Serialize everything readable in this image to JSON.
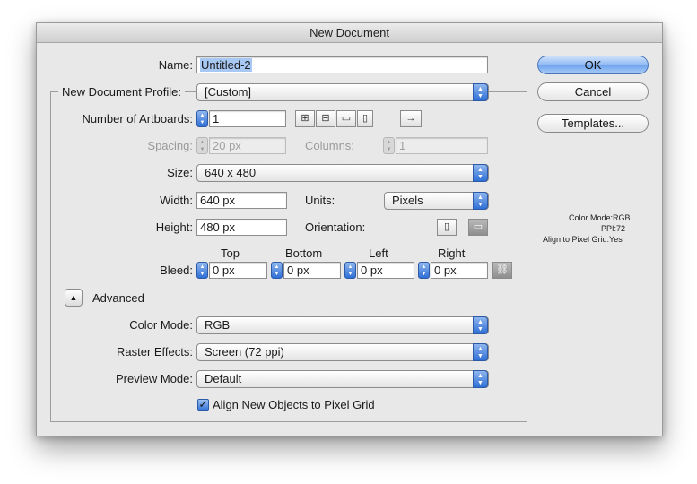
{
  "window": {
    "title": "New Document"
  },
  "name": {
    "label": "Name:",
    "value": "Untitled-2"
  },
  "profile": {
    "label": "New Document Profile:",
    "value": "[Custom]"
  },
  "artboards": {
    "label": "Number of Artboards:",
    "value": "1",
    "direction_arrow": "→"
  },
  "spacing": {
    "label": "Spacing:",
    "value": "20 px"
  },
  "columns": {
    "label": "Columns:",
    "value": "1"
  },
  "size": {
    "label": "Size:",
    "value": "640 x 480"
  },
  "width": {
    "label": "Width:",
    "value": "640 px"
  },
  "units": {
    "label": "Units:",
    "value": "Pixels"
  },
  "height": {
    "label": "Height:",
    "value": "480 px"
  },
  "orientation": {
    "label": "Orientation:"
  },
  "bleed": {
    "label": "Bleed:",
    "top": {
      "label": "Top",
      "value": "0 px"
    },
    "bottom": {
      "label": "Bottom",
      "value": "0 px"
    },
    "left": {
      "label": "Left",
      "value": "0 px"
    },
    "right": {
      "label": "Right",
      "value": "0 px"
    }
  },
  "advanced": {
    "label": "Advanced"
  },
  "color_mode": {
    "label": "Color Mode:",
    "value": "RGB"
  },
  "raster_effects": {
    "label": "Raster Effects:",
    "value": "Screen (72 ppi)"
  },
  "preview_mode": {
    "label": "Preview Mode:",
    "value": "Default"
  },
  "align_pixel_grid": {
    "label": "Align New Objects to Pixel Grid",
    "checked": true
  },
  "buttons": {
    "ok": "OK",
    "cancel": "Cancel",
    "templates": "Templates..."
  },
  "summary": {
    "color_mode_label": "Color Mode:",
    "color_mode_value": "RGB",
    "ppi_label": "PPI:",
    "ppi_value": "72",
    "align_label": "Align to Pixel Grid:",
    "align_value": "Yes"
  },
  "icons": {
    "stepper": "up-down-arrows-icon",
    "popup": "up-down-arrows-icon",
    "grid_by_row": "grid-by-row-icon",
    "grid_by_column": "grid-by-column-icon",
    "arrange_by_row": "arrange-by-row-icon",
    "arrange_by_column": "arrange-by-column-icon",
    "portrait": "portrait-icon",
    "landscape": "landscape-icon",
    "link": "link-icon",
    "disclosure": "disclosure-triangle-icon",
    "checkmark": "checkmark-icon"
  },
  "colors": {
    "accent": "#3a78d8",
    "selection": "#a8c8f4",
    "window_bg": "#e8e8e8"
  }
}
